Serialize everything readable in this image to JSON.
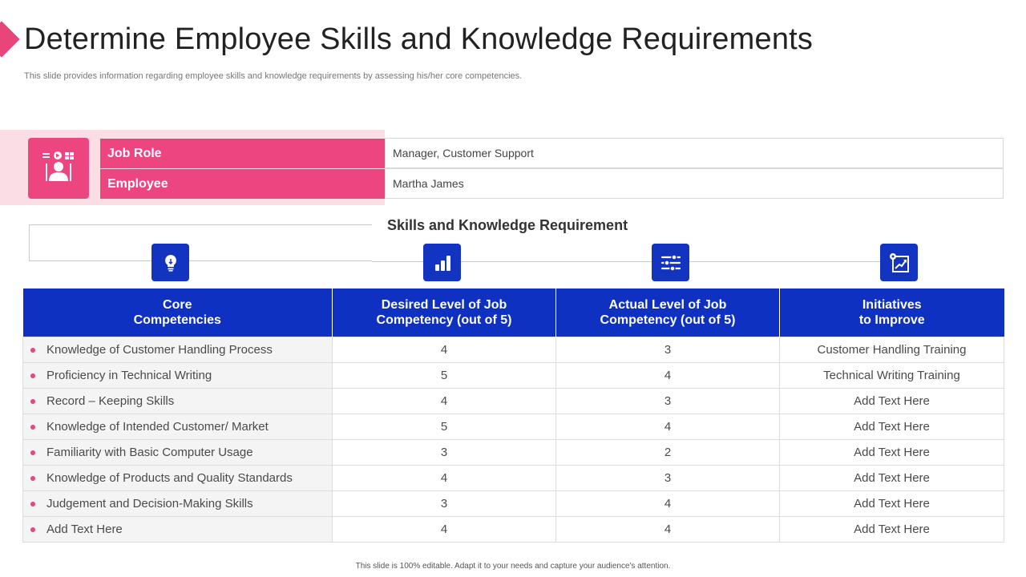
{
  "title": "Determine Employee Skills and Knowledge Requirements",
  "subtitle": "This slide provides information regarding employee skills and knowledge requirements by assessing his/her core competencies.",
  "job_info": {
    "icon": "employee-presentation-icon",
    "rows": [
      {
        "label": "Job Role",
        "value": "Manager,  Customer Support"
      },
      {
        "label": "Employee",
        "value": "Martha James"
      }
    ]
  },
  "section_title": "Skills and Knowledge Requirement",
  "column_icons": [
    "lightbulb-icon",
    "bar-chart-icon",
    "sliders-icon",
    "growth-chart-icon"
  ],
  "table": {
    "headers": [
      "Core\nCompetencies",
      "Desired Level of Job\nCompetency (out of 5)",
      "Actual Level of Job\nCompetency (out of 5)",
      "Initiatives\nto Improve"
    ],
    "rows": [
      {
        "competency": "Knowledge of Customer Handling  Process",
        "desired": "4",
        "actual": "3",
        "initiative": "Customer Handling Training"
      },
      {
        "competency": "Proficiency in Technical Writing",
        "desired": "5",
        "actual": "4",
        "initiative": "Technical Writing Training"
      },
      {
        "competency": "Record – Keeping Skills",
        "desired": "4",
        "actual": "3",
        "initiative": "Add Text Here"
      },
      {
        "competency": "Knowledge of Intended Customer/ Market",
        "desired": "5",
        "actual": "4",
        "initiative": "Add Text Here"
      },
      {
        "competency": "Familiarity with Basic Computer Usage",
        "desired": "3",
        "actual": "2",
        "initiative": "Add Text Here"
      },
      {
        "competency": "Knowledge of Products and Quality Standards",
        "desired": "4",
        "actual": "3",
        "initiative": "Add Text Here"
      },
      {
        "competency": "Judgement and Decision-Making Skills",
        "desired": "3",
        "actual": "4",
        "initiative": "Add Text Here"
      },
      {
        "competency": "Add Text Here",
        "desired": "4",
        "actual": "4",
        "initiative": "Add Text Here"
      }
    ]
  },
  "footer": "This slide is 100% editable.  Adapt it to your needs and capture your audience's attention.",
  "colors": {
    "accent_pink": "#ec4580",
    "pink_light": "#fbdde6",
    "header_blue": "#0f31c2"
  }
}
